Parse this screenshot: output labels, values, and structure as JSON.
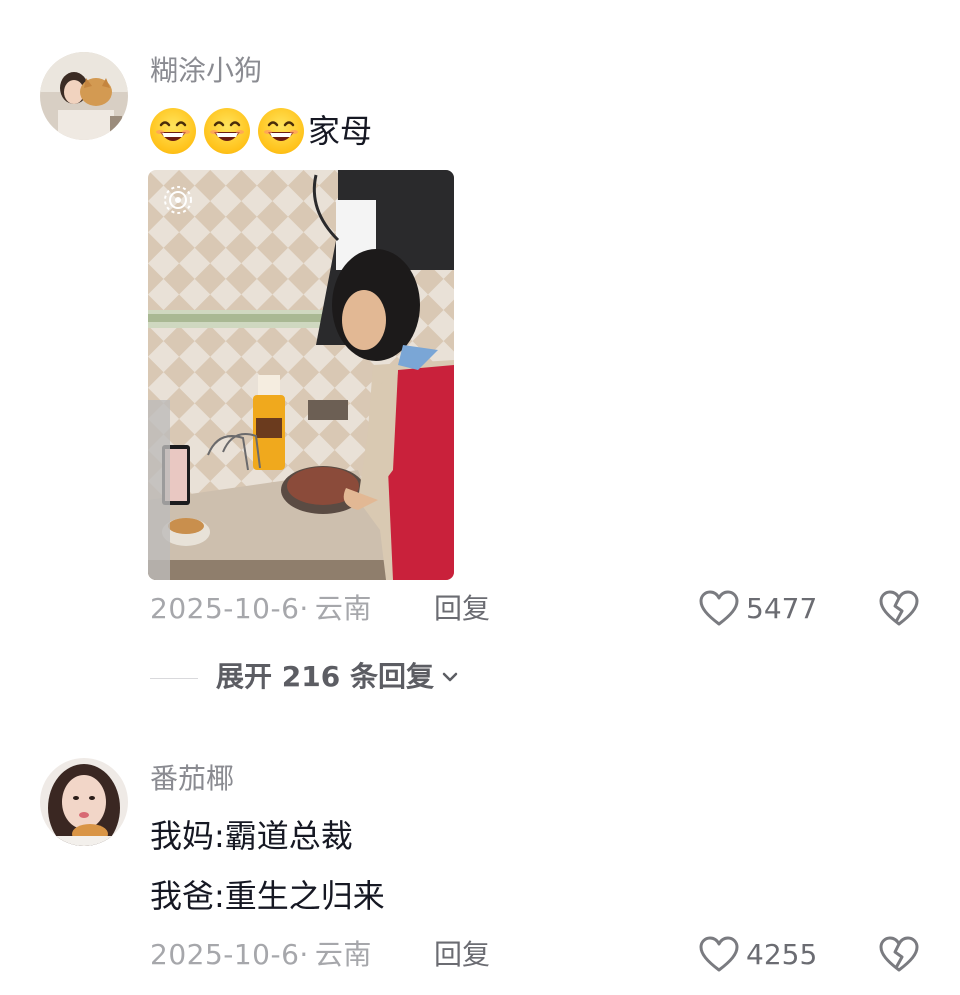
{
  "comments": [
    {
      "username": "糊涂小狗",
      "emoji_icon": "grinning-face-icon",
      "emoji_count": 3,
      "text": "家母",
      "date": "2025-10-6·",
      "location": "云南",
      "reply_label": "回复",
      "likes": "5477",
      "expand_label": "展开 216 条回复"
    },
    {
      "username": "番茄椰",
      "lines": [
        "我妈:霸道总裁",
        "我爸:重生之归来"
      ],
      "date": "2025-10-6·",
      "location": "云南",
      "reply_label": "回复",
      "likes": "4255"
    }
  ],
  "colors": {
    "accent_text": "#161823",
    "muted_text": "#a6a7ab",
    "username_text": "#8a8b91"
  }
}
